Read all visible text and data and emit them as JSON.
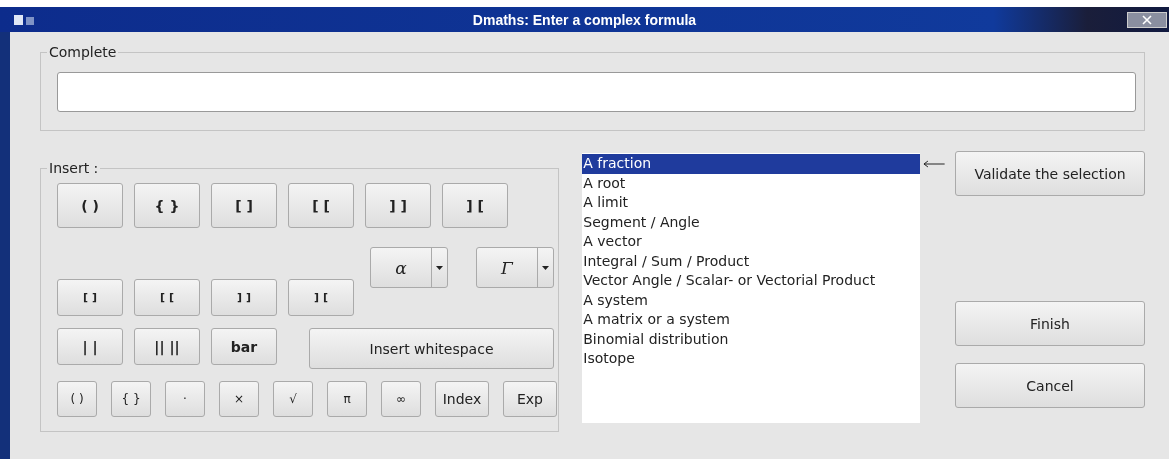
{
  "window": {
    "title": "Dmaths: Enter a complex formula"
  },
  "complete": {
    "label": "Complete"
  },
  "insert": {
    "label": "Insert :",
    "row_1": [
      "( )",
      "{ }",
      "[ ]",
      "[ [",
      "] ]",
      "] ["
    ],
    "dropdowns": [
      "α",
      "Γ"
    ],
    "row_2": [
      "[ ]",
      "[ [",
      "] ]",
      "] ["
    ],
    "row_3": [
      "| |",
      "|| ||",
      "bar"
    ],
    "whitespace_button": "Insert whitespace",
    "row_4": [
      "( )",
      "{ }",
      "·",
      "×",
      "√",
      "π",
      "∞",
      "Index",
      "Exp"
    ]
  },
  "list": [
    {
      "label": "A fraction",
      "selected": true
    },
    {
      "label": "A root",
      "selected": false
    },
    {
      "label": "A limit",
      "selected": false
    },
    {
      "label": "Segment / Angle",
      "selected": false
    },
    {
      "label": "A vector",
      "selected": false
    },
    {
      "label": "Integral / Sum / Product",
      "selected": false
    },
    {
      "label": "Vector Angle / Scalar- or Vectorial Product",
      "selected": false
    },
    {
      "label": "A system",
      "selected": false
    },
    {
      "label": "A matrix or a system",
      "selected": false
    },
    {
      "label": "Binomial distribution",
      "selected": false
    },
    {
      "label": "Isotope",
      "selected": false
    }
  ],
  "buttons": {
    "validate": "Validate the selection",
    "finish": "Finish",
    "cancel": "Cancel"
  }
}
